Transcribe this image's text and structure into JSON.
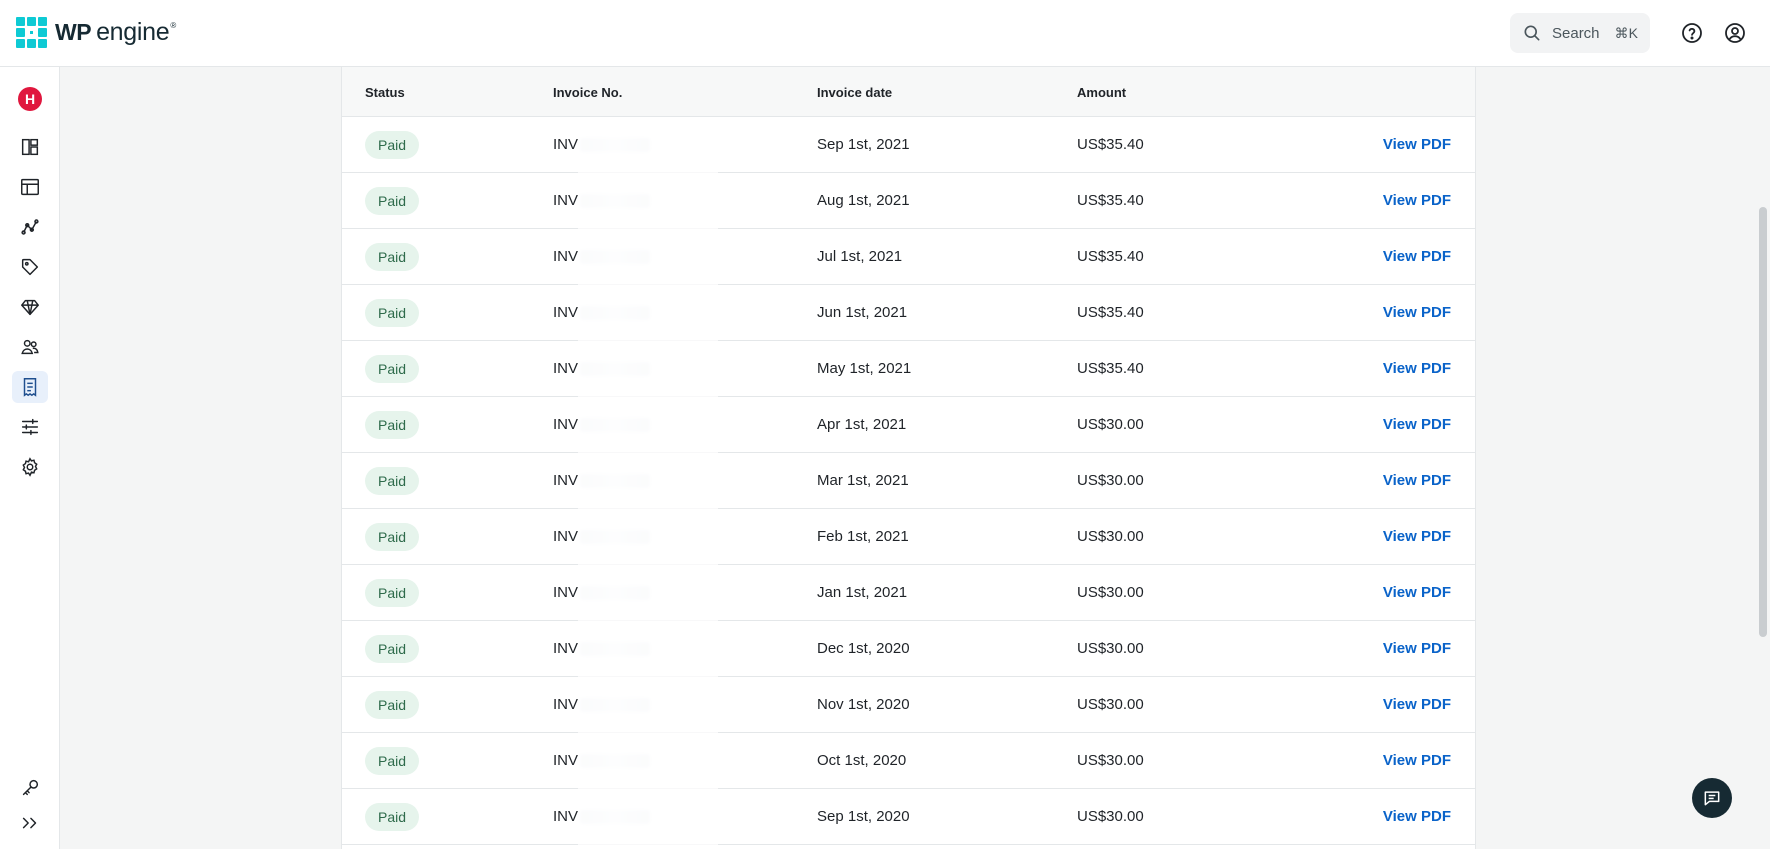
{
  "header": {
    "logo_wp": "WP",
    "logo_engine": "engine",
    "logo_tm": "®",
    "search_label": "Search",
    "search_shortcut": "⌘K",
    "help_icon": "help-circle-icon",
    "account_icon": "user-circle-icon"
  },
  "sidebar": {
    "avatar_letter": "H",
    "items": [
      {
        "name": "dashboard",
        "icon": "layout-grid-icon"
      },
      {
        "name": "sites",
        "icon": "browser-window-icon"
      },
      {
        "name": "analytics",
        "icon": "line-graph-icon"
      },
      {
        "name": "tags",
        "icon": "tag-icon"
      },
      {
        "name": "plans",
        "icon": "diamond-icon"
      },
      {
        "name": "users",
        "icon": "users-icon"
      },
      {
        "name": "billing",
        "icon": "receipt-icon",
        "active": true
      },
      {
        "name": "settings-adjust",
        "icon": "sliders-icon"
      },
      {
        "name": "settings",
        "icon": "gear-icon"
      },
      {
        "name": "api-keys",
        "icon": "key-icon"
      },
      {
        "name": "expand",
        "icon": "chevrons-right-icon"
      }
    ]
  },
  "table": {
    "columns": [
      "Status",
      "Invoice No.",
      "Invoice date",
      "Amount"
    ],
    "rows": [
      {
        "status": "Paid",
        "invoice_prefix": "INV",
        "date": "Sep 1st, 2021",
        "amount": "US$35.40",
        "action": "View PDF"
      },
      {
        "status": "Paid",
        "invoice_prefix": "INV",
        "date": "Aug 1st, 2021",
        "amount": "US$35.40",
        "action": "View PDF"
      },
      {
        "status": "Paid",
        "invoice_prefix": "INV",
        "date": "Jul 1st, 2021",
        "amount": "US$35.40",
        "action": "View PDF"
      },
      {
        "status": "Paid",
        "invoice_prefix": "INV",
        "date": "Jun 1st, 2021",
        "amount": "US$35.40",
        "action": "View PDF"
      },
      {
        "status": "Paid",
        "invoice_prefix": "INV",
        "date": "May 1st, 2021",
        "amount": "US$35.40",
        "action": "View PDF"
      },
      {
        "status": "Paid",
        "invoice_prefix": "INV",
        "date": "Apr 1st, 2021",
        "amount": "US$30.00",
        "action": "View PDF"
      },
      {
        "status": "Paid",
        "invoice_prefix": "INV",
        "date": "Mar 1st, 2021",
        "amount": "US$30.00",
        "action": "View PDF"
      },
      {
        "status": "Paid",
        "invoice_prefix": "INV",
        "date": "Feb 1st, 2021",
        "amount": "US$30.00",
        "action": "View PDF"
      },
      {
        "status": "Paid",
        "invoice_prefix": "INV",
        "date": "Jan 1st, 2021",
        "amount": "US$30.00",
        "action": "View PDF"
      },
      {
        "status": "Paid",
        "invoice_prefix": "INV",
        "date": "Dec 1st, 2020",
        "amount": "US$30.00",
        "action": "View PDF"
      },
      {
        "status": "Paid",
        "invoice_prefix": "INV",
        "date": "Nov 1st, 2020",
        "amount": "US$30.00",
        "action": "View PDF"
      },
      {
        "status": "Paid",
        "invoice_prefix": "INV",
        "date": "Oct 1st, 2020",
        "amount": "US$30.00",
        "action": "View PDF"
      },
      {
        "status": "Paid",
        "invoice_prefix": "INV",
        "date": "Sep 1st, 2020",
        "amount": "US$30.00",
        "action": "View PDF"
      }
    ]
  },
  "chat": {
    "icon": "chat-bubble-icon"
  },
  "colors": {
    "brand_teal": "#0ecad4",
    "link_blue": "#0a63c9",
    "paid_bg": "#e6f4ec",
    "avatar_red": "#e0173e"
  }
}
